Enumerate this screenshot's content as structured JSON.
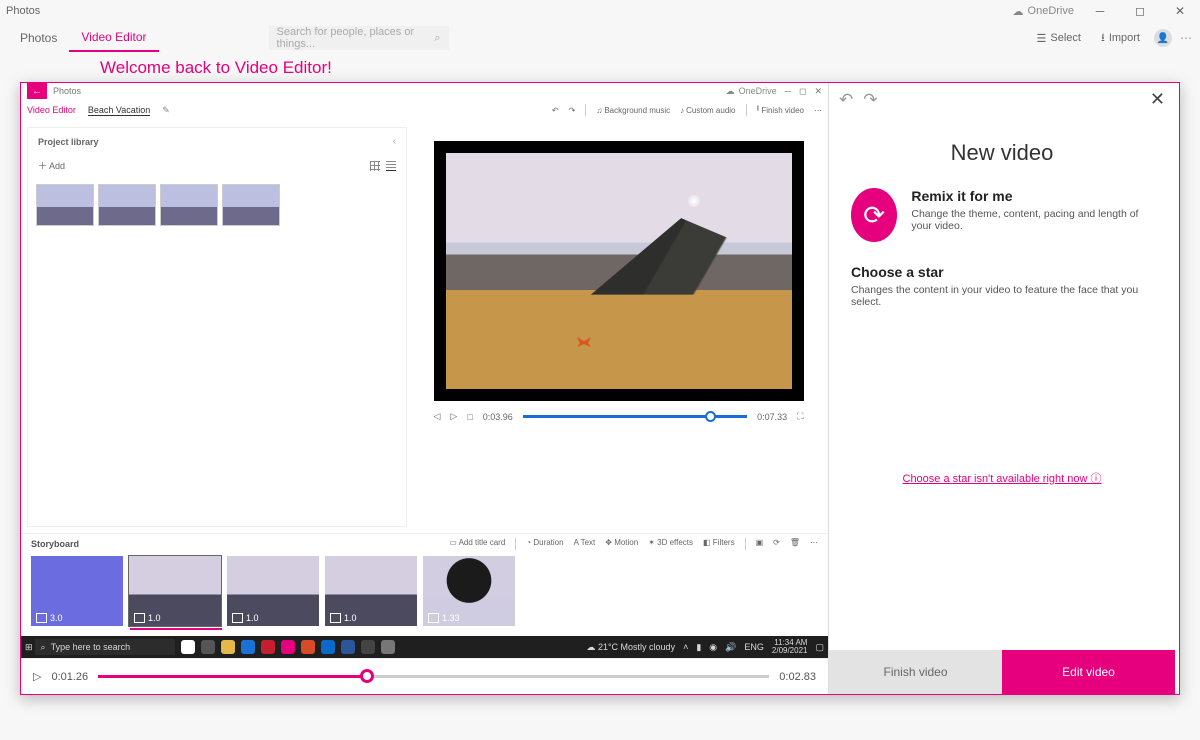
{
  "app": {
    "title": "Photos",
    "onedrive": "OneDrive",
    "tabs": {
      "photos": "Photos",
      "video_editor": "Video Editor"
    },
    "search_placeholder": "Search for people, places or things...",
    "select": "Select",
    "import": "Import",
    "welcome": "Welcome back to Video Editor!"
  },
  "inner": {
    "title": "Photos",
    "onedrive": "OneDrive",
    "tabs": {
      "ve": "Video Editor",
      "project": "Beach Vacation"
    },
    "toolbar": {
      "bgmusic": "Background music",
      "custom_audio": "Custom audio",
      "finish": "Finish video"
    },
    "library": {
      "title": "Project library",
      "add": "Add"
    },
    "preview": {
      "prev": "◁",
      "play": "▷",
      "stop": "□",
      "t1": "0:03.96",
      "t2": "0:07.33"
    },
    "storyboard": {
      "label": "Storyboard",
      "tools": {
        "add_title": "Add title card",
        "duration": "Duration",
        "text": "Text",
        "motion": "Motion",
        "effects": "3D effects",
        "filters": "Filters"
      },
      "durations": [
        "3.0",
        "1.0",
        "1.0",
        "1.0",
        "1.33"
      ]
    }
  },
  "taskbar": {
    "search_placeholder": "Type here to search",
    "weather": "21°C  Mostly cloudy",
    "lang": "ENG",
    "time": "11:34 AM",
    "date": "2/09/2021"
  },
  "timeline": {
    "t1": "0:01.26",
    "t2": "0:02.83"
  },
  "panel": {
    "title": "New video",
    "remix": {
      "title": "Remix it for me",
      "desc": "Change the theme, content, pacing and length of your video."
    },
    "star": {
      "title": "Choose a star",
      "desc": "Changes the content in your video to feature the face that you select."
    },
    "star_link": "Choose a star isn't available right now ⓘ",
    "finish": "Finish video",
    "edit": "Edit video"
  }
}
